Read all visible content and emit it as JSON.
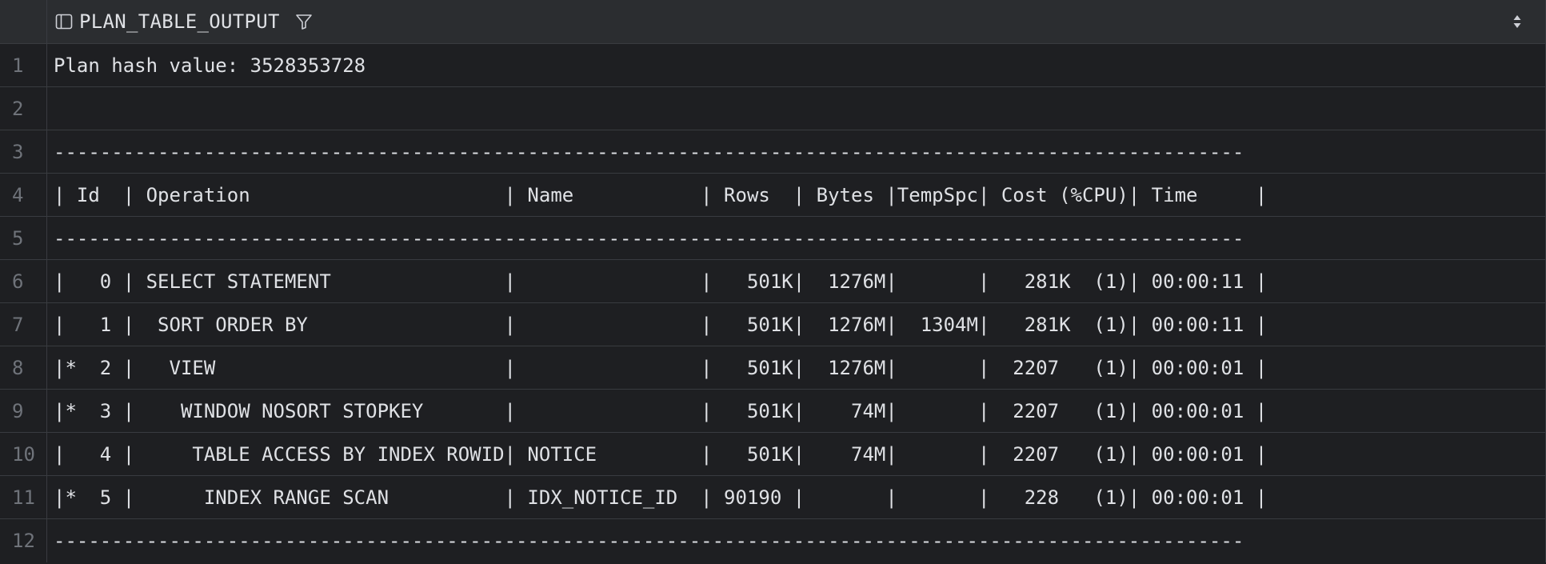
{
  "column": {
    "title": "PLAN_TABLE_OUTPUT",
    "icon": "table-column-icon",
    "filter_icon": "filter-icon",
    "sort_icon": "sort-updown-icon"
  },
  "rows": [
    {
      "num": "1",
      "text": "Plan hash value: 3528353728"
    },
    {
      "num": "2",
      "text": ""
    },
    {
      "num": "3",
      "text": "-------------------------------------------------------------------------------------------------------"
    },
    {
      "num": "4",
      "text": "| Id  | Operation                      | Name           | Rows  | Bytes |TempSpc| Cost (%CPU)| Time     |"
    },
    {
      "num": "5",
      "text": "-------------------------------------------------------------------------------------------------------"
    },
    {
      "num": "6",
      "text": "|   0 | SELECT STATEMENT               |                |   501K|  1276M|       |   281K  (1)| 00:00:11 |"
    },
    {
      "num": "7",
      "text": "|   1 |  SORT ORDER BY                 |                |   501K|  1276M|  1304M|   281K  (1)| 00:00:11 |"
    },
    {
      "num": "8",
      "text": "|*  2 |   VIEW                         |                |   501K|  1276M|       |  2207   (1)| 00:00:01 |"
    },
    {
      "num": "9",
      "text": "|*  3 |    WINDOW NOSORT STOPKEY       |                |   501K|    74M|       |  2207   (1)| 00:00:01 |"
    },
    {
      "num": "10",
      "text": "|   4 |     TABLE ACCESS BY INDEX ROWID| NOTICE         |   501K|    74M|       |  2207   (1)| 00:00:01 |"
    },
    {
      "num": "11",
      "text": "|*  5 |      INDEX RANGE SCAN          | IDX_NOTICE_ID  | 90190 |       |       |   228   (1)| 00:00:01 |"
    },
    {
      "num": "12",
      "text": "-------------------------------------------------------------------------------------------------------"
    }
  ]
}
